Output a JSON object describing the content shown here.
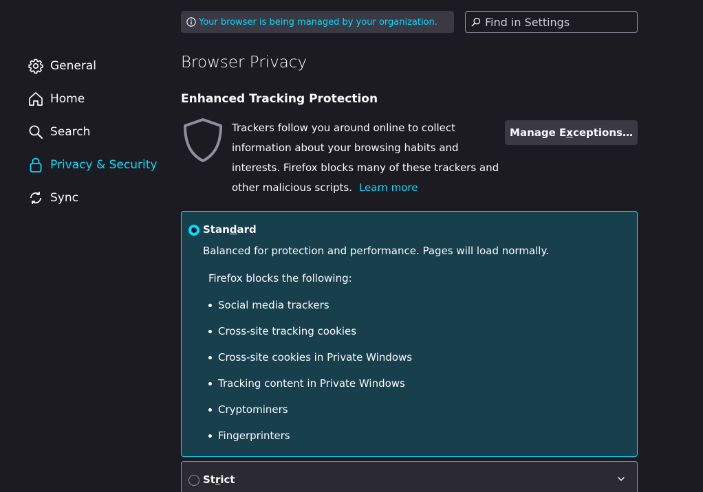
{
  "managed_banner": {
    "text": "Your browser is being managed by your organization.",
    "icon": "info-icon"
  },
  "search": {
    "placeholder": "Find in Settings",
    "icon": "search-icon"
  },
  "sidebar": {
    "items": [
      {
        "label": "General",
        "icon": "gear-icon",
        "active": false
      },
      {
        "label": "Home",
        "icon": "home-icon",
        "active": false
      },
      {
        "label": "Search",
        "icon": "search-icon",
        "active": false
      },
      {
        "label": "Privacy & Security",
        "icon": "lock-icon",
        "active": true
      },
      {
        "label": "Sync",
        "icon": "sync-icon",
        "active": false
      }
    ]
  },
  "main": {
    "page_title": "Browser Privacy",
    "section_title": "Enhanced Tracking Protection",
    "description": "Trackers follow you around online to collect information about your browsing habits and interests. Firefox blocks many of these trackers and other malicious scripts.",
    "learn_more": "Learn more",
    "manage_exceptions": {
      "before": "Manage E",
      "accel": "x",
      "after": "ceptions…"
    },
    "standard": {
      "label_before": "Stan",
      "label_accel": "d",
      "label_after": "ard",
      "description": "Balanced for protection and performance. Pages will load normally.",
      "blocks_heading": "Firefox blocks the following:",
      "blocks": [
        "Social media trackers",
        "Cross-site tracking cookies",
        "Cross-site cookies in Private Windows",
        "Tracking content in Private Windows",
        "Cryptominers",
        "Fingerprinters"
      ],
      "selected": true
    },
    "strict": {
      "label_before": "St",
      "label_accel": "r",
      "label_after": "ict",
      "selected": false
    }
  },
  "colors": {
    "background": "#1c1b22",
    "accent": "#00ddff",
    "selected_card": "#173f4c",
    "text": "#fbfbfe"
  }
}
